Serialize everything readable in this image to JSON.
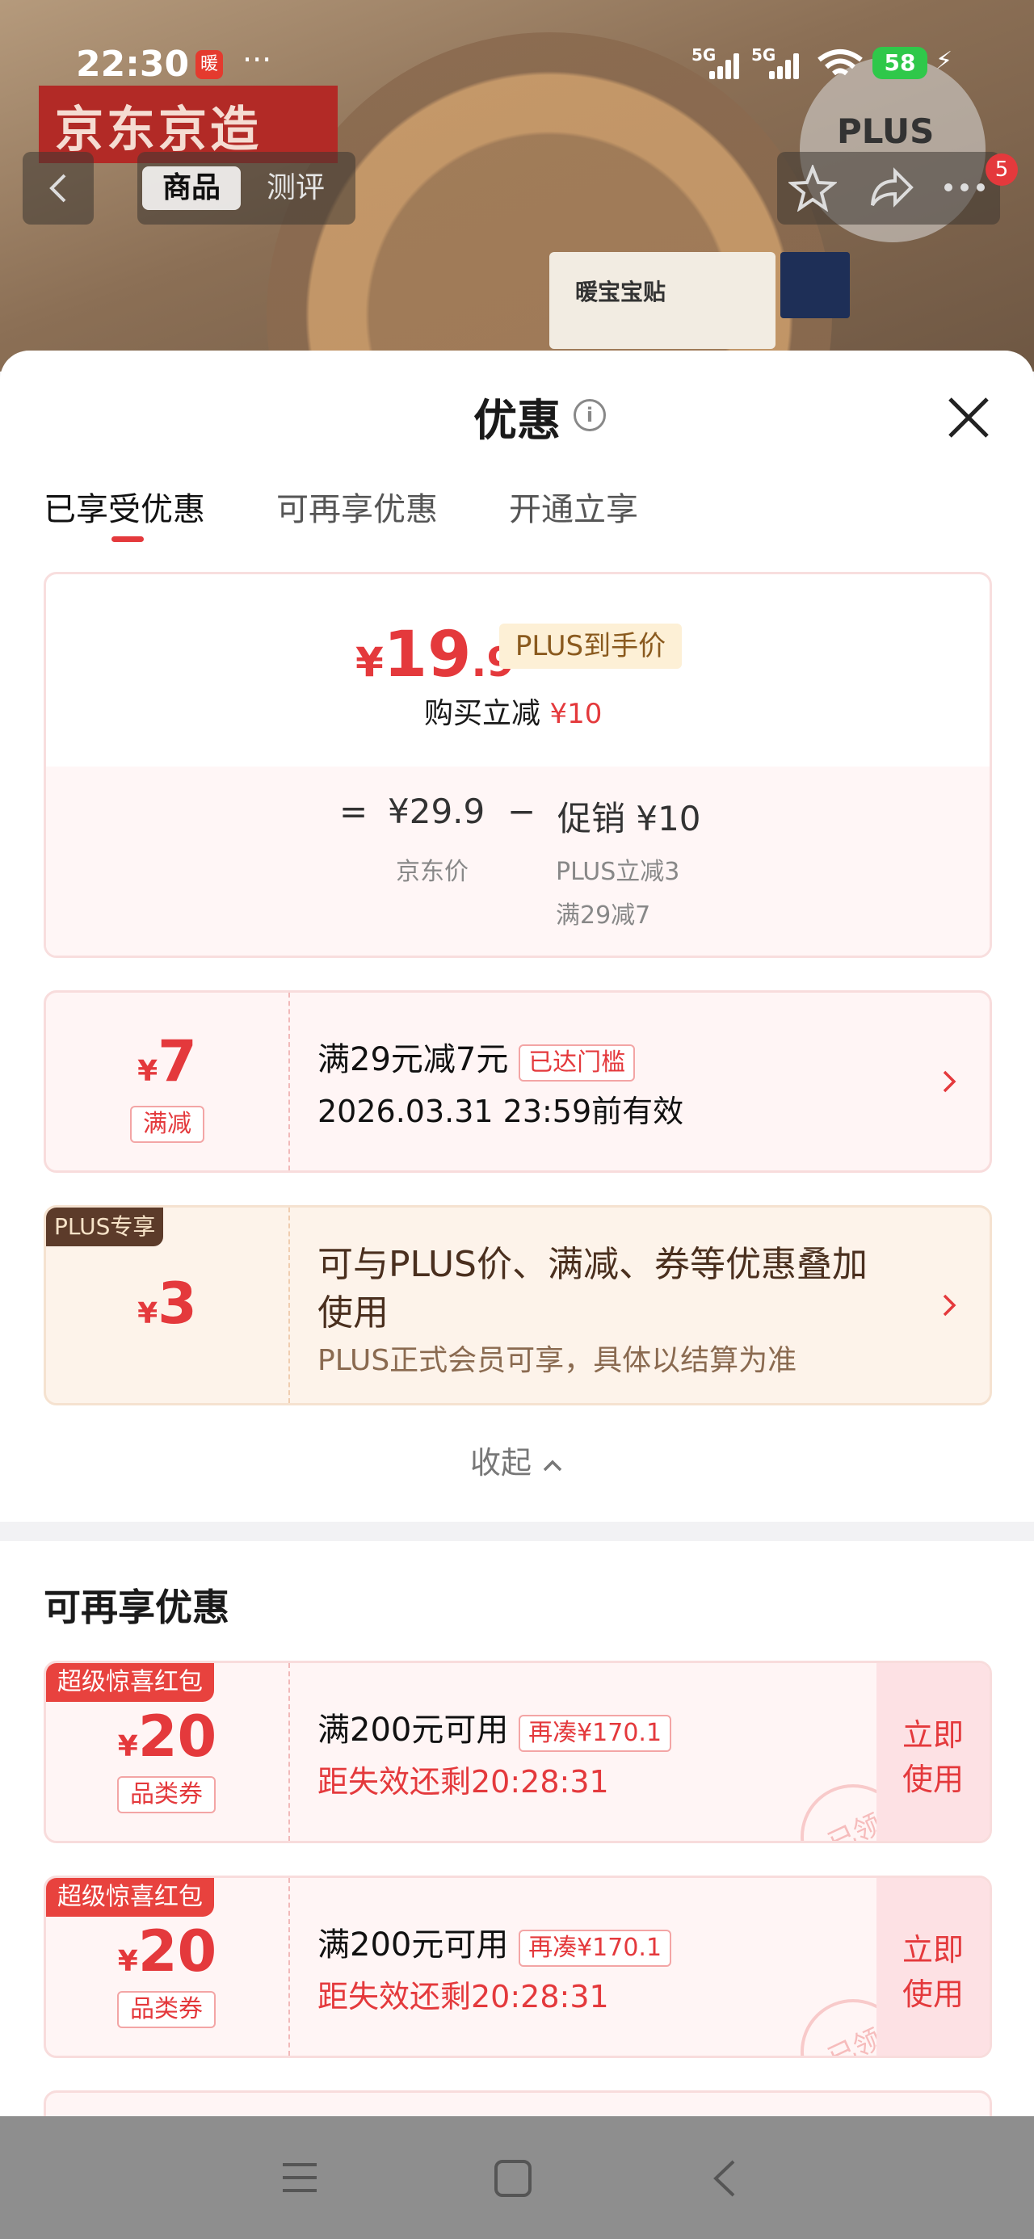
{
  "status_bar": {
    "time": "22:30",
    "app_badge": "暖",
    "more": "···",
    "net1": "5G",
    "net2": "5G",
    "battery": "58"
  },
  "background": {
    "brand": "京东京造",
    "plus_text": "PLUS",
    "pack_label": "暖宝宝贴"
  },
  "top_nav": {
    "tabs": [
      "商品",
      "测评"
    ],
    "badge": "5"
  },
  "sheet": {
    "title": "优惠",
    "info_icon": "i",
    "tabs": [
      "已享受优惠",
      "可再享优惠",
      "开通立享"
    ],
    "price_card": {
      "currency": "¥",
      "price_int": "19",
      "price_dec": ".9",
      "tag": "PLUS到手价",
      "buy_cut_label": "购买立减",
      "buy_cut_value": "¥10",
      "eq": "=",
      "jd_price": "¥29.9",
      "minus": "−",
      "promo": "促销 ¥10",
      "jd_price_label": "京东价",
      "promo_detail_1": "PLUS立减3",
      "promo_detail_2": "满29减7"
    },
    "discount_1": {
      "currency": "¥",
      "amount": "7",
      "type": "满减",
      "title": "满29元减7元",
      "tag": "已达门槛",
      "expire": "2026.03.31 23:59前有效"
    },
    "discount_2": {
      "ribbon": "PLUS专享",
      "currency": "¥",
      "amount": "3",
      "title_1": "可与PLUS价、满减、券等优惠叠加",
      "title_2": "使用",
      "note": "PLUS正式会员可享，具体以结算为准"
    },
    "collapse": "收起"
  },
  "more_section": {
    "title": "可再享优惠",
    "coupons": [
      {
        "ribbon": "超级惊喜红包",
        "currency": "¥",
        "amount": "20",
        "type": "品类券",
        "title": "满200元可用",
        "tag": "再凑¥170.1",
        "countdown": "距失效还剩20:28:31",
        "action_1": "立即",
        "action_2": "使用",
        "stamp": "已领"
      },
      {
        "ribbon": "超级惊喜红包",
        "currency": "¥",
        "amount": "20",
        "type": "品类券",
        "title": "满200元可用",
        "tag": "再凑¥170.1",
        "countdown": "距失效还剩20:28:31",
        "action_1": "立即",
        "action_2": "使用",
        "stamp": "已领"
      }
    ]
  },
  "colors": {
    "accent": "#e4393c",
    "plus_gold": "#8a5a1e"
  }
}
